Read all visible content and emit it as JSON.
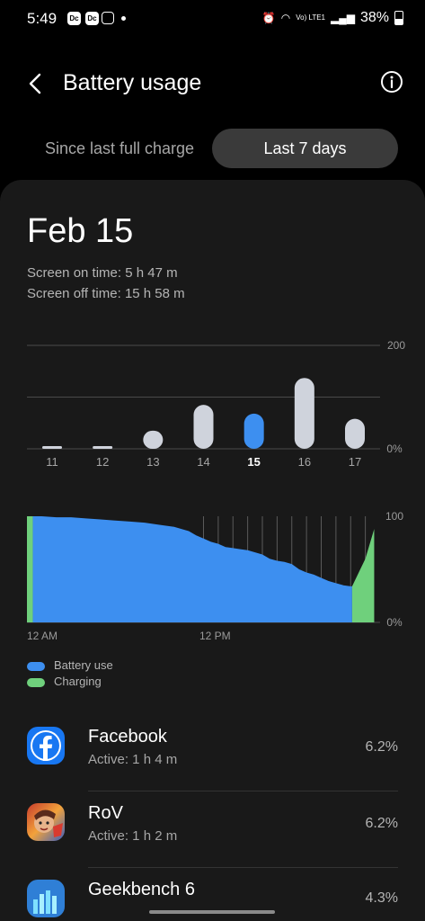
{
  "status_bar": {
    "time": "5:49",
    "notif_1": "Dc",
    "notif_2": "Dc",
    "battery_percent": "38%",
    "network_label": "Vo) LTE1"
  },
  "header": {
    "title": "Battery usage",
    "back_icon": "chevron-left-icon",
    "info_icon": "info-icon"
  },
  "tabs": [
    {
      "label": "Since last full charge",
      "active": false
    },
    {
      "label": "Last 7 days",
      "active": true
    }
  ],
  "selected_day": {
    "date": "Feb 15",
    "screen_on": "Screen on time: 5 h 47 m",
    "screen_off": "Screen off time: 15 h 58 m"
  },
  "colors": {
    "accent_blue": "#3d8ff0",
    "charging_green": "#6fd07c",
    "bar_gray": "#cfd3dc"
  },
  "chart_data": [
    {
      "type": "bar",
      "categories": [
        "11",
        "12",
        "13",
        "14",
        "15",
        "16",
        "17"
      ],
      "values": [
        4,
        3,
        35,
        85,
        68,
        137,
        58
      ],
      "selected_category": "15",
      "ylim": [
        0,
        200
      ],
      "y_tick_labels": [
        "200",
        "0%"
      ],
      "grid": true
    },
    {
      "type": "area",
      "x_tick_labels": [
        "12 AM",
        "12 PM"
      ],
      "y_tick_labels": [
        "100",
        "0%"
      ],
      "ylim": [
        0,
        100
      ],
      "xlim": [
        0,
        24
      ],
      "series": [
        {
          "name": "Battery use",
          "x": [
            0.4,
            1,
            2,
            3,
            4,
            5,
            6,
            7,
            8,
            9,
            10,
            10.5,
            11,
            11.5,
            12,
            12.5,
            13,
            13.5,
            14,
            14.5,
            15,
            15.5,
            16,
            16.5,
            17,
            17.5,
            18,
            18.5,
            19,
            19.5,
            20,
            20.5,
            21,
            21.5,
            22,
            22.1
          ],
          "y": [
            100,
            100,
            99,
            99,
            98,
            97,
            96,
            95,
            94,
            92,
            90,
            88,
            86,
            82,
            79,
            76,
            74,
            71,
            70,
            69,
            68,
            66,
            64,
            60,
            58,
            57,
            55,
            50,
            47,
            45,
            42,
            39,
            37,
            35,
            34,
            34
          ]
        },
        {
          "name": "Charging",
          "x": [
            0,
            0.4,
            22.1,
            23,
            23.6
          ],
          "y": [
            100,
            100,
            34,
            60,
            88
          ]
        }
      ],
      "grid": true
    }
  ],
  "legend": [
    {
      "label": "Battery use",
      "color": "#3d8ff0"
    },
    {
      "label": "Charging",
      "color": "#6fd07c"
    }
  ],
  "apps": [
    {
      "name": "Facebook",
      "active": "Active: 1 h 4 m",
      "percent": "6.2%",
      "icon": "facebook-icon"
    },
    {
      "name": "RoV",
      "active": "Active: 1 h 2 m",
      "percent": "6.2%",
      "icon": "rov-game-icon"
    },
    {
      "name": "Geekbench 6",
      "active": "",
      "percent": "4.3%",
      "icon": "geekbench-icon"
    }
  ]
}
